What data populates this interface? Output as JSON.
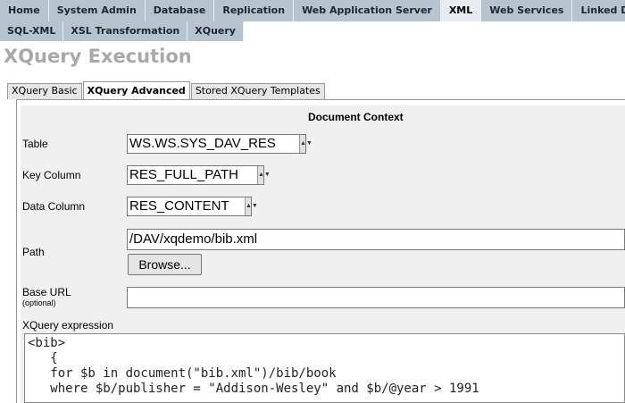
{
  "topnav": {
    "tabs": [
      "Home",
      "System Admin",
      "Database",
      "Replication",
      "Web Application Server",
      "XML",
      "Web Services",
      "Linked Data"
    ]
  },
  "subnav": {
    "tabs": [
      "SQL-XML",
      "XSL Transformation",
      "XQuery"
    ]
  },
  "page_title": "XQuery Execution",
  "panel_tabs": [
    "XQuery Basic",
    "XQuery Advanced",
    "Stored XQuery Templates"
  ],
  "document_context": {
    "heading": "Document Context",
    "table_label": "Table",
    "table_value": "WS.WS.SYS_DAV_RES",
    "key_label": "Key Column",
    "key_value": "RES_FULL_PATH",
    "data_label": "Data Column",
    "data_value": "RES_CONTENT",
    "path_label": "Path",
    "path_value": "/DAV/xqdemo/bib.xml",
    "browse_label": "Browse...",
    "baseurl_label": "Base URL",
    "baseurl_hint": "(optional)",
    "baseurl_value": ""
  },
  "xquery": {
    "label": "XQuery expression",
    "code": "<bib>\n   {\n   for $b in document(\"bib.xml\")/bib/book\n   where $b/publisher = \"Addison-Wesley\" and $b/@year > 1991"
  }
}
